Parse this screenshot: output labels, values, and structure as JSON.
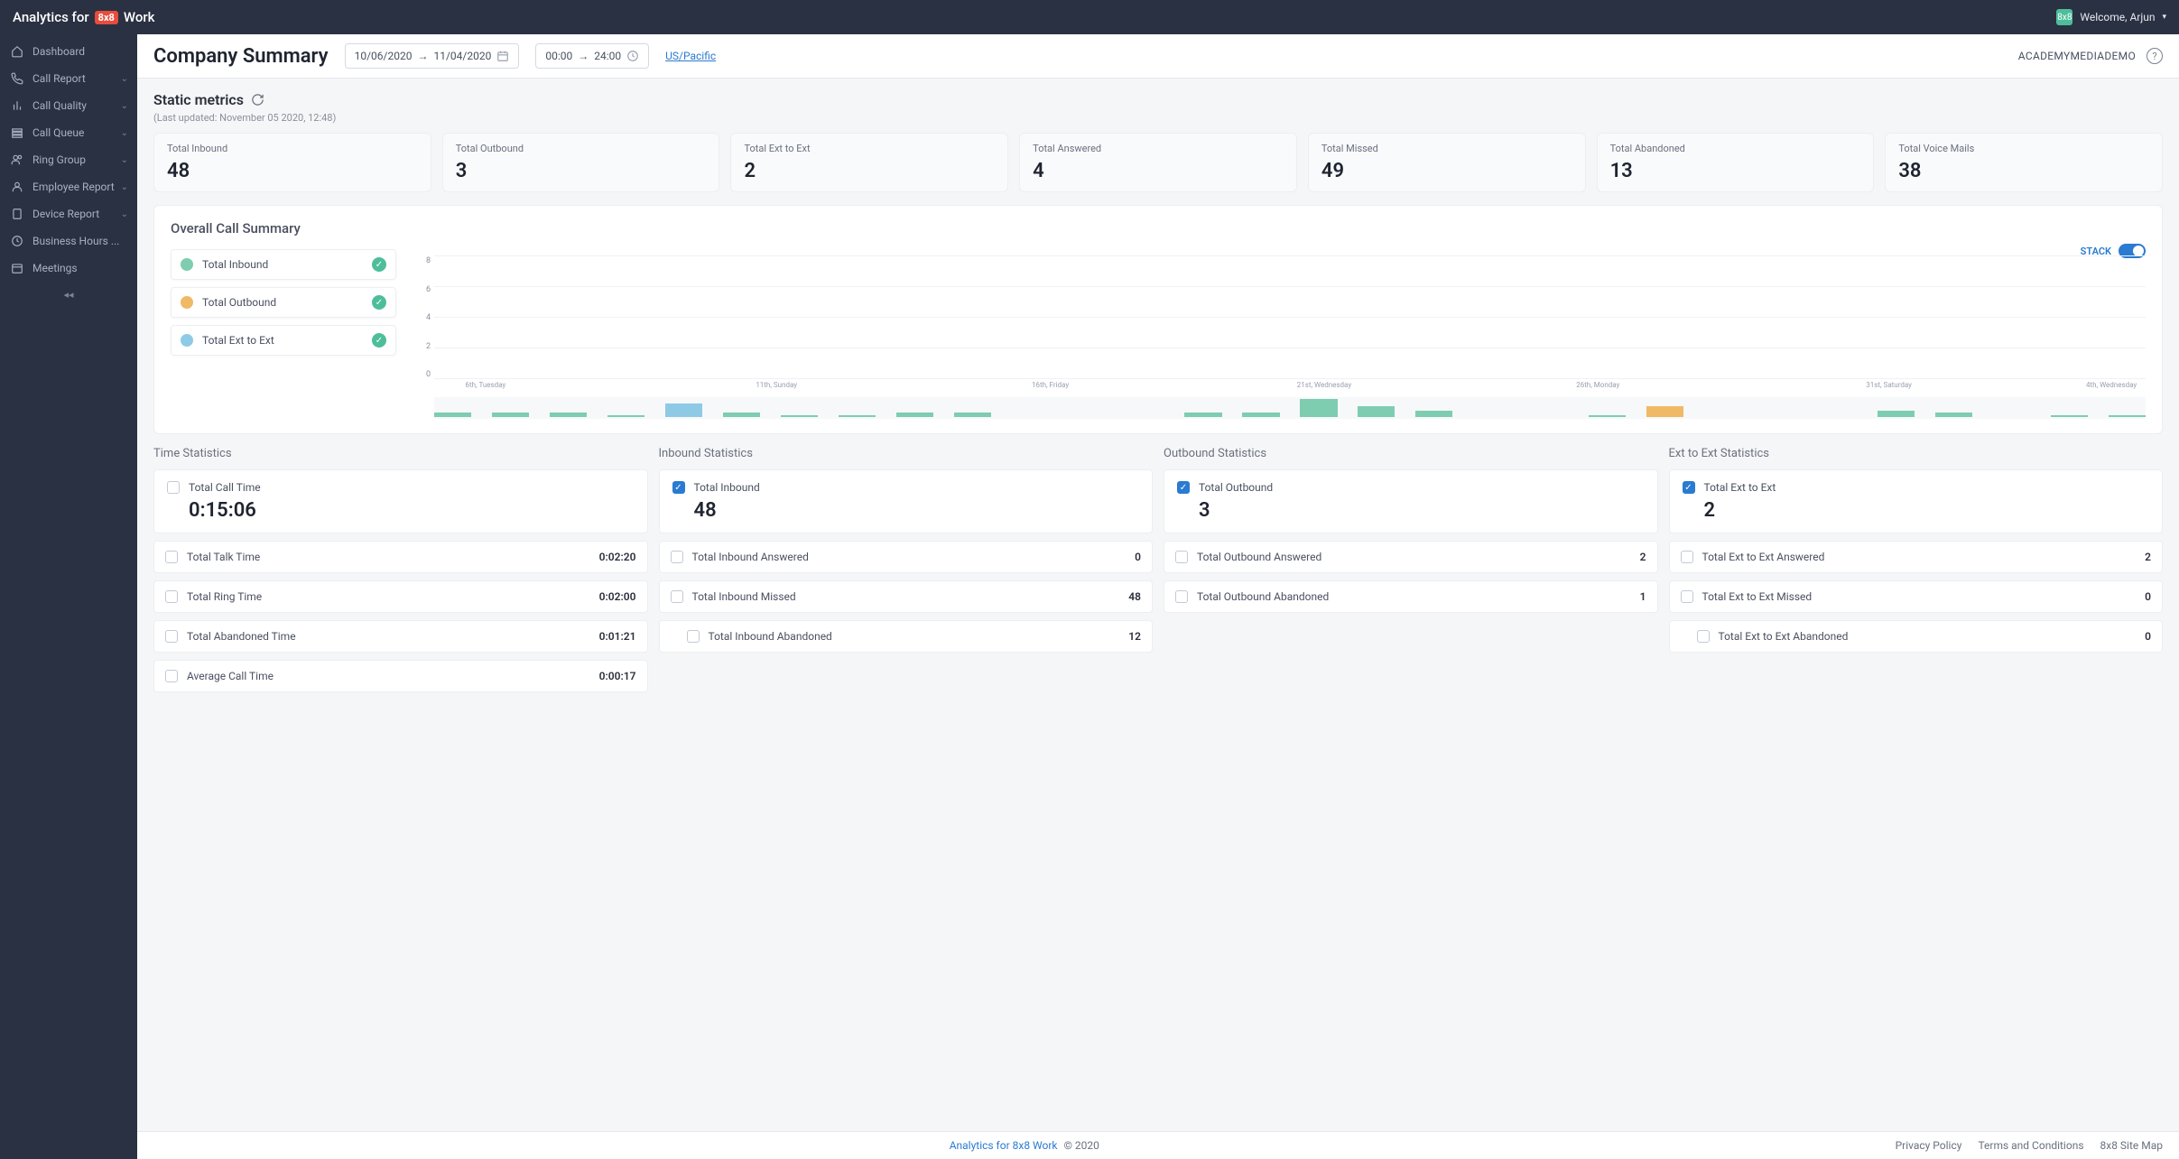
{
  "app": {
    "title_prefix": "Analytics for",
    "product": "8x8",
    "product_suffix": "Work",
    "welcome": "Welcome, Arjun"
  },
  "sidebar": {
    "items": [
      {
        "label": "Dashboard",
        "icon": "home",
        "expandable": false,
        "active": false
      },
      {
        "label": "Call Report",
        "icon": "phone",
        "expandable": true,
        "active": false
      },
      {
        "label": "Call Quality",
        "icon": "bars",
        "expandable": true,
        "active": false
      },
      {
        "label": "Call Queue",
        "icon": "queue",
        "expandable": true,
        "active": false
      },
      {
        "label": "Ring Group",
        "icon": "users",
        "expandable": true,
        "active": false
      },
      {
        "label": "Employee Report",
        "icon": "user",
        "expandable": true,
        "active": false
      },
      {
        "label": "Device Report",
        "icon": "device",
        "expandable": true,
        "active": false
      },
      {
        "label": "Business Hours ...",
        "icon": "clock",
        "expandable": false,
        "active": false
      },
      {
        "label": "Meetings",
        "icon": "calendar",
        "expandable": false,
        "active": false
      }
    ]
  },
  "page": {
    "title": "Company Summary",
    "date_range": {
      "from": "10/06/2020",
      "to": "11/04/2020"
    },
    "time_range": {
      "from": "00:00",
      "to": "24:00"
    },
    "timezone": "US/Pacific",
    "account": "ACADEMYMEDIADEMO"
  },
  "static_metrics": {
    "title": "Static metrics",
    "last_updated": "(Last updated: November 05 2020, 12:48)",
    "cards": [
      {
        "label": "Total Inbound",
        "value": "48"
      },
      {
        "label": "Total Outbound",
        "value": "3"
      },
      {
        "label": "Total Ext to Ext",
        "value": "2"
      },
      {
        "label": "Total Answered",
        "value": "4"
      },
      {
        "label": "Total Missed",
        "value": "49"
      },
      {
        "label": "Total Abandoned",
        "value": "13"
      },
      {
        "label": "Total Voice Mails",
        "value": "38"
      }
    ]
  },
  "overall": {
    "title": "Overall Call Summary",
    "stack_label": "STACK",
    "legend": [
      {
        "label": "Total Inbound",
        "color": "#7ecdb0"
      },
      {
        "label": "Total Outbound",
        "color": "#f0b965"
      },
      {
        "label": "Total Ext to Ext",
        "color": "#8ecae6"
      }
    ]
  },
  "chart_data": {
    "type": "bar",
    "stacked": true,
    "ylim": [
      0,
      8
    ],
    "yticks": [
      0,
      2,
      4,
      6,
      8
    ],
    "categories": [
      "6",
      "7",
      "8",
      "9",
      "10",
      "11",
      "12",
      "13",
      "14",
      "15",
      "16",
      "17",
      "18",
      "19",
      "20",
      "21",
      "22",
      "23",
      "24",
      "25",
      "26",
      "27",
      "28",
      "29",
      "30",
      "31",
      "1",
      "2",
      "3",
      "4"
    ],
    "x_ticks": [
      {
        "pos_pct": 3,
        "label": "6th, Tuesday"
      },
      {
        "pos_pct": 20,
        "label": "11th, Sunday"
      },
      {
        "pos_pct": 36,
        "label": "16th, Friday"
      },
      {
        "pos_pct": 52,
        "label": "21st, Wednesday"
      },
      {
        "pos_pct": 68,
        "label": "26th, Monday"
      },
      {
        "pos_pct": 85,
        "label": "31st, Saturday"
      },
      {
        "pos_pct": 98,
        "label": "4th, Wednesday"
      }
    ],
    "series": [
      {
        "name": "Total Inbound",
        "color": "#7ecdb0",
        "values": [
          2,
          2,
          2,
          1,
          4,
          2,
          1,
          1,
          2,
          2,
          0,
          0,
          0,
          2,
          2,
          8,
          5,
          3,
          0,
          0,
          1,
          2,
          0,
          0,
          0,
          3,
          2,
          0,
          1,
          1
        ]
      },
      {
        "name": "Total Outbound",
        "color": "#f0b965",
        "values": [
          0,
          0,
          0,
          0,
          0,
          0,
          0,
          0,
          0,
          0,
          0,
          0,
          0,
          0,
          0,
          0,
          0,
          0,
          0,
          0,
          0,
          3,
          0,
          0,
          0,
          0,
          0,
          0,
          0,
          0
        ]
      },
      {
        "name": "Total Ext to Ext",
        "color": "#8ecae6",
        "values": [
          0,
          0,
          0,
          0,
          2,
          0,
          0,
          0,
          0,
          0,
          0,
          0,
          0,
          0,
          0,
          0,
          0,
          0,
          0,
          0,
          0,
          0,
          0,
          0,
          0,
          0,
          0,
          0,
          0,
          0
        ]
      }
    ]
  },
  "stats": {
    "time": {
      "title": "Time Statistics",
      "head": {
        "label": "Total Call Time",
        "value": "0:15:06"
      },
      "rows": [
        {
          "label": "Total Talk Time",
          "value": "0:02:20"
        },
        {
          "label": "Total Ring Time",
          "value": "0:02:00"
        },
        {
          "label": "Total Abandoned Time",
          "value": "0:01:21"
        },
        {
          "label": "Average Call Time",
          "value": "0:00:17"
        }
      ]
    },
    "inbound": {
      "title": "Inbound Statistics",
      "head": {
        "label": "Total Inbound",
        "value": "48",
        "checked": true
      },
      "rows": [
        {
          "label": "Total Inbound Answered",
          "value": "0"
        },
        {
          "label": "Total Inbound Missed",
          "value": "48"
        },
        {
          "label": "Total Inbound Abandoned",
          "value": "12",
          "indent": true
        }
      ]
    },
    "outbound": {
      "title": "Outbound Statistics",
      "head": {
        "label": "Total Outbound",
        "value": "3",
        "checked": true
      },
      "rows": [
        {
          "label": "Total Outbound Answered",
          "value": "2"
        },
        {
          "label": "Total Outbound Abandoned",
          "value": "1"
        }
      ]
    },
    "ext": {
      "title": "Ext to Ext Statistics",
      "head": {
        "label": "Total Ext to Ext",
        "value": "2",
        "checked": true
      },
      "rows": [
        {
          "label": "Total Ext to Ext Answered",
          "value": "2"
        },
        {
          "label": "Total Ext to Ext Missed",
          "value": "0"
        },
        {
          "label": "Total Ext to Ext Abandoned",
          "value": "0",
          "indent": true
        }
      ]
    }
  },
  "footer": {
    "brand": "Analytics for 8x8 Work",
    "copyright": "© 2020",
    "links": [
      "Privacy Policy",
      "Terms and Conditions",
      "8x8 Site Map"
    ]
  }
}
